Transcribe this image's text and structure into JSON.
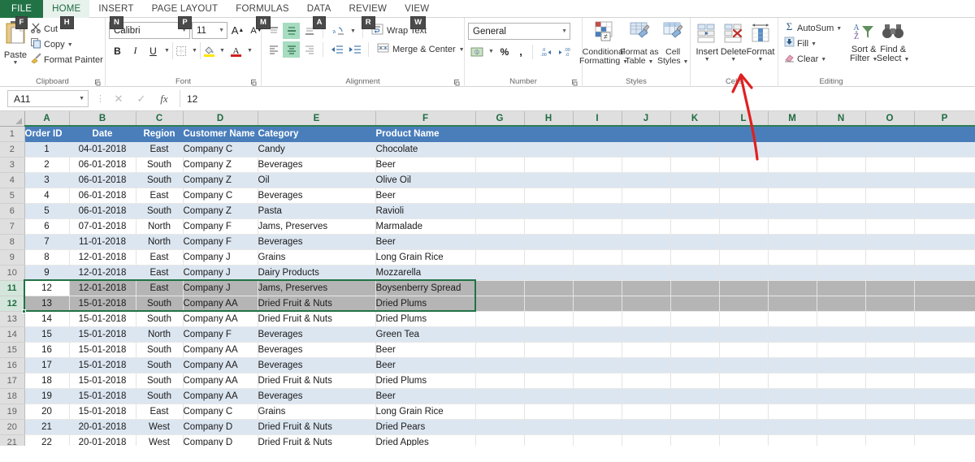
{
  "window": {
    "app": "Microsoft Excel"
  },
  "tabs": [
    {
      "label": "FILE",
      "keytip": "F",
      "active": false,
      "file": true
    },
    {
      "label": "HOME",
      "keytip": "H",
      "active": true,
      "file": false
    },
    {
      "label": "INSERT",
      "keytip": "N",
      "active": false,
      "file": false
    },
    {
      "label": "PAGE LAYOUT",
      "keytip": "P",
      "active": false,
      "file": false
    },
    {
      "label": "FORMULAS",
      "keytip": "M",
      "active": false,
      "file": false
    },
    {
      "label": "DATA",
      "keytip": "A",
      "active": false,
      "file": false
    },
    {
      "label": "REVIEW",
      "keytip": "R",
      "active": false,
      "file": false
    },
    {
      "label": "VIEW",
      "keytip": "W",
      "active": false,
      "file": false
    }
  ],
  "ribbon": {
    "clipboard": {
      "group_label": "Clipboard",
      "paste_label": "Paste",
      "cut_label": "Cut",
      "copy_label": "Copy",
      "format_painter_label": "Format Painter"
    },
    "font": {
      "group_label": "Font",
      "font_name": "Calibri",
      "font_size": "11",
      "grow_font": "A",
      "shrink_font": "A",
      "bold": "B",
      "italic": "I",
      "underline": "U"
    },
    "alignment": {
      "group_label": "Alignment",
      "wrap_text_label": "Wrap Text",
      "merge_center_label": "Merge & Center"
    },
    "number": {
      "group_label": "Number",
      "format": "General",
      "percent": "%",
      "comma": ","
    },
    "styles": {
      "group_label": "Styles",
      "conditional_formatting": "Conditional\nFormatting",
      "conditional_formatting_l1": "Conditional",
      "conditional_formatting_l2": "Formatting",
      "format_as_table_l1": "Format as",
      "format_as_table_l2": "Table",
      "cell_styles_l1": "Cell",
      "cell_styles_l2": "Styles"
    },
    "cells": {
      "group_label": "Cells",
      "insert_label": "Insert",
      "delete_label": "Delete",
      "format_label": "Format"
    },
    "editing": {
      "group_label": "Editing",
      "autosum_label": "AutoSum",
      "fill_label": "Fill",
      "clear_label": "Clear",
      "sort_filter_l1": "Sort &",
      "sort_filter_l2": "Filter",
      "find_select_l1": "Find &",
      "find_select_l2": "Select"
    }
  },
  "formula_bar": {
    "name_box_value": "A11",
    "cancel": "✕",
    "enter": "✓",
    "function": "fx",
    "formula_value": "12"
  },
  "grid": {
    "columns": [
      "A",
      "B",
      "C",
      "D",
      "E",
      "F",
      "G",
      "H",
      "I",
      "J",
      "K",
      "L",
      "M",
      "N",
      "O",
      "P"
    ],
    "active_cell": "A11",
    "selected_rows": [
      11,
      12
    ],
    "rows": [
      {
        "n": 1,
        "header": true,
        "cells": [
          "Order ID",
          "Date",
          "Region",
          "Customer Name",
          "Category",
          "Product Name"
        ]
      },
      {
        "n": 2,
        "band": true,
        "cells": [
          "1",
          "04-01-2018",
          "East",
          "Company C",
          "Candy",
          "Chocolate"
        ]
      },
      {
        "n": 3,
        "band": false,
        "cells": [
          "2",
          "06-01-2018",
          "South",
          "Company Z",
          "Beverages",
          "Beer"
        ]
      },
      {
        "n": 4,
        "band": true,
        "cells": [
          "3",
          "06-01-2018",
          "South",
          "Company Z",
          "Oil",
          "Olive Oil"
        ]
      },
      {
        "n": 5,
        "band": false,
        "cells": [
          "4",
          "06-01-2018",
          "East",
          "Company C",
          "Beverages",
          "Beer"
        ]
      },
      {
        "n": 6,
        "band": true,
        "cells": [
          "5",
          "06-01-2018",
          "South",
          "Company Z",
          "Pasta",
          "Ravioli"
        ]
      },
      {
        "n": 7,
        "band": false,
        "cells": [
          "6",
          "07-01-2018",
          "North",
          "Company F",
          "Jams, Preserves",
          "Marmalade"
        ]
      },
      {
        "n": 8,
        "band": true,
        "cells": [
          "7",
          "11-01-2018",
          "North",
          "Company F",
          "Beverages",
          "Beer"
        ]
      },
      {
        "n": 9,
        "band": false,
        "cells": [
          "8",
          "12-01-2018",
          "East",
          "Company J",
          "Grains",
          "Long Grain Rice"
        ]
      },
      {
        "n": 10,
        "band": true,
        "cells": [
          "9",
          "12-01-2018",
          "East",
          "Company J",
          "Dairy Products",
          "Mozzarella"
        ]
      },
      {
        "n": 11,
        "selected": true,
        "cells": [
          "12",
          "12-01-2018",
          "East",
          "Company J",
          "Jams, Preserves",
          "Boysenberry Spread"
        ]
      },
      {
        "n": 12,
        "selected": true,
        "cells": [
          "13",
          "15-01-2018",
          "South",
          "Company AA",
          "Dried Fruit & Nuts",
          "Dried Plums"
        ]
      },
      {
        "n": 13,
        "band": false,
        "cells": [
          "14",
          "15-01-2018",
          "South",
          "Company AA",
          "Dried Fruit & Nuts",
          "Dried Plums"
        ]
      },
      {
        "n": 14,
        "band": true,
        "cells": [
          "15",
          "15-01-2018",
          "North",
          "Company F",
          "Beverages",
          "Green Tea"
        ]
      },
      {
        "n": 15,
        "band": false,
        "cells": [
          "16",
          "15-01-2018",
          "South",
          "Company AA",
          "Beverages",
          "Beer"
        ]
      },
      {
        "n": 16,
        "band": true,
        "cells": [
          "17",
          "15-01-2018",
          "South",
          "Company AA",
          "Beverages",
          "Beer"
        ]
      },
      {
        "n": 17,
        "band": false,
        "cells": [
          "18",
          "15-01-2018",
          "South",
          "Company AA",
          "Dried Fruit & Nuts",
          "Dried Plums"
        ]
      },
      {
        "n": 18,
        "band": true,
        "cells": [
          "19",
          "15-01-2018",
          "South",
          "Company AA",
          "Beverages",
          "Beer"
        ]
      },
      {
        "n": 19,
        "band": false,
        "cells": [
          "20",
          "15-01-2018",
          "East",
          "Company C",
          "Grains",
          "Long Grain Rice"
        ]
      },
      {
        "n": 20,
        "band": true,
        "cells": [
          "21",
          "20-01-2018",
          "West",
          "Company D",
          "Dried Fruit & Nuts",
          "Dried Pears"
        ]
      },
      {
        "n": 21,
        "band": false,
        "cells": [
          "22",
          "20-01-2018",
          "West",
          "Company D",
          "Dried Fruit & Nuts",
          "Dried Apples"
        ]
      }
    ]
  },
  "annotation": {
    "type": "red-arrow",
    "points_to": "insert-dropdown",
    "color": "#e02020"
  },
  "colors": {
    "excel_green": "#217346",
    "tab_active_bg": "#e8f2ec",
    "header_row_blue": "#4a7ebb",
    "band_blue": "#dce6f1",
    "selection_gray": "#b5b5b5",
    "annotation_red": "#e02020"
  }
}
